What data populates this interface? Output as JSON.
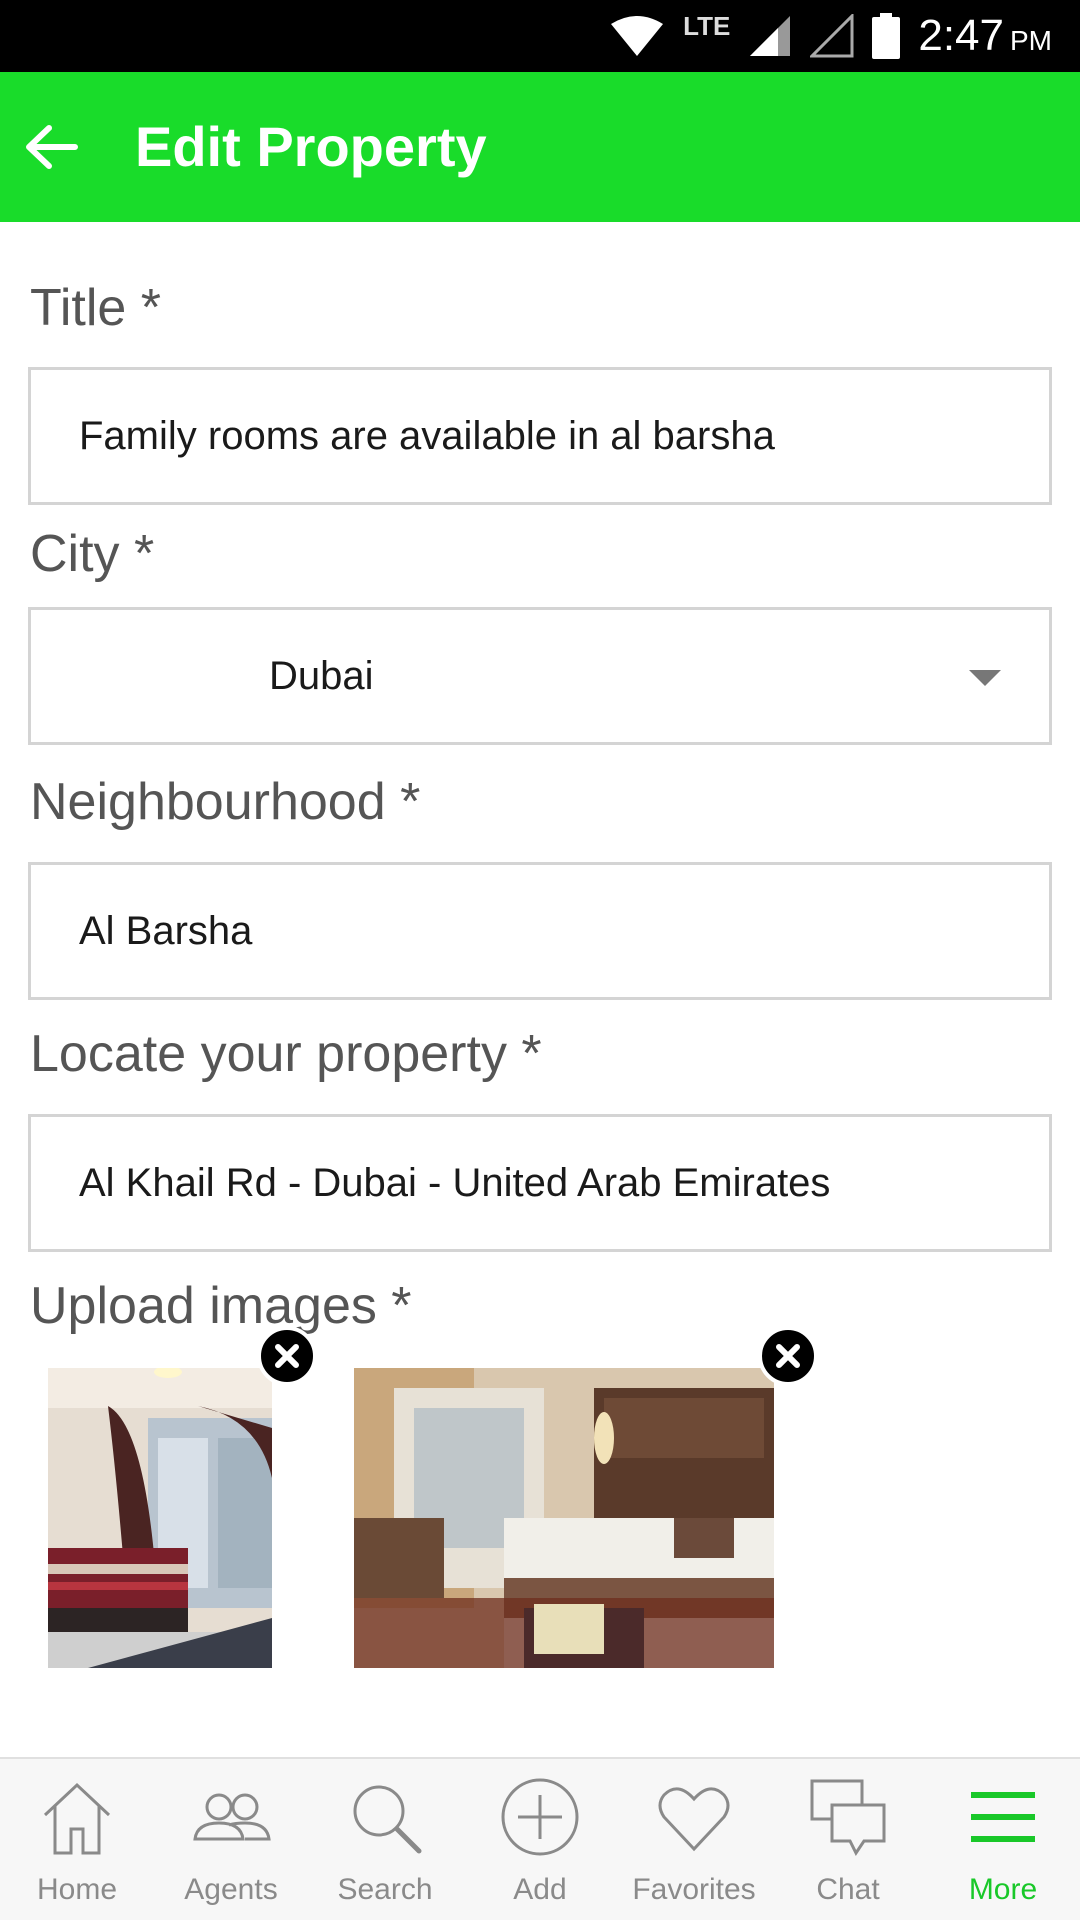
{
  "status_bar": {
    "time": "2:47",
    "ampm": "PM",
    "network": "LTE"
  },
  "app_bar": {
    "title": "Edit Property",
    "back_icon": "arrow-left-icon"
  },
  "form": {
    "title": {
      "label": "Title *",
      "value": "Family rooms are available in al barsha"
    },
    "city": {
      "label": "City *",
      "value": "Dubai"
    },
    "neighbourhood": {
      "label": "Neighbourhood *",
      "value": "Al Barsha"
    },
    "location": {
      "label": "Locate your property *",
      "value": "Al Khail Rd - Dubai - United Arab Emirates"
    },
    "images": {
      "label": "Upload images *",
      "items": [
        "bedroom-photo-1",
        "bedroom-photo-2"
      ]
    }
  },
  "bottom_nav": {
    "items": [
      {
        "label": "Home",
        "icon": "home-icon"
      },
      {
        "label": "Agents",
        "icon": "agents-icon"
      },
      {
        "label": "Search",
        "icon": "search-icon"
      },
      {
        "label": "Add",
        "icon": "add-icon"
      },
      {
        "label": "Favorites",
        "icon": "heart-icon"
      },
      {
        "label": "Chat",
        "icon": "chat-icon"
      },
      {
        "label": "More",
        "icon": "menu-icon",
        "active": true
      }
    ]
  },
  "colors": {
    "accent": "#19dc2a",
    "nav_active": "#19c829",
    "nav_inactive": "#8a8a8a"
  }
}
